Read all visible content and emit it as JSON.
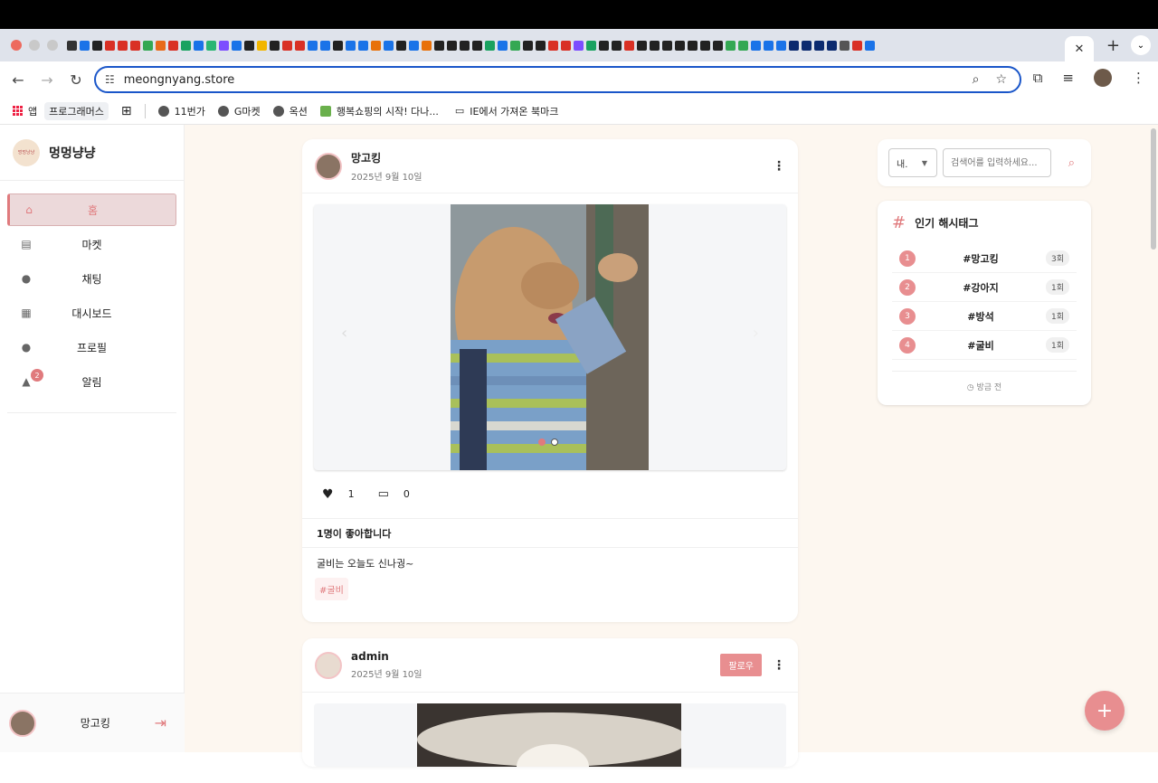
{
  "browser": {
    "url": "meongnyang.store",
    "bookmarks": [
      {
        "label": "앱"
      },
      {
        "label": "프로그래머스"
      },
      {
        "label": "11번가"
      },
      {
        "label": "G마켓"
      },
      {
        "label": "옥션"
      },
      {
        "label": "행복쇼핑의 시작! 다나..."
      },
      {
        "label": "IE에서 가져온 북마크"
      }
    ]
  },
  "brand": {
    "name": "멍멍냥냥",
    "logo_text": "멍멍냥냥"
  },
  "sidebar": {
    "items": [
      {
        "label": "홈",
        "icon": "home-icon",
        "glyph": "⌂"
      },
      {
        "label": "마켓",
        "icon": "store-icon",
        "glyph": "▤"
      },
      {
        "label": "채팅",
        "icon": "chat-icon",
        "glyph": "●"
      },
      {
        "label": "대시보드",
        "icon": "dashboard-icon",
        "glyph": "▦"
      },
      {
        "label": "프로필",
        "icon": "person-icon",
        "glyph": "●"
      },
      {
        "label": "알림",
        "icon": "bell-icon",
        "glyph": "▲",
        "badge": "2"
      }
    ],
    "user": {
      "name": "망고킹"
    }
  },
  "posts": [
    {
      "user": "망고킹",
      "date": "2025년 9월 10일",
      "likes_count": "1",
      "comments_count": "0",
      "likes_text": "1명이 좋아합니다",
      "caption": "굴비는 오늘도 신나궝~",
      "tag": "#굴비"
    },
    {
      "user": "admin",
      "date": "2025년 9월 10일",
      "follow_label": "팔로우"
    }
  ],
  "search": {
    "select_value": "내.",
    "placeholder": "검색어를 입력하세요..."
  },
  "hashtags": {
    "title": "인기 해시태그",
    "items": [
      {
        "rank": "1",
        "tag": "#망고킹",
        "count": "3회"
      },
      {
        "rank": "2",
        "tag": "#강아지",
        "count": "1회"
      },
      {
        "rank": "3",
        "tag": "#방석",
        "count": "1회"
      },
      {
        "rank": "4",
        "tag": "#굴비",
        "count": "1회"
      }
    ],
    "updated": "방금 전"
  },
  "colors": {
    "accent": "#e07a7d",
    "page_bg": "#fdf7f0"
  }
}
